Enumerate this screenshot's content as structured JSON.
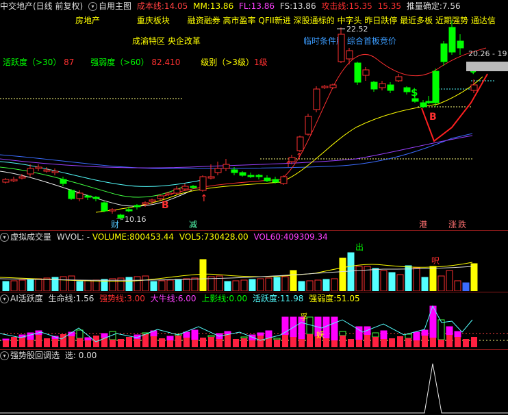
{
  "header": {
    "title": "中交地产(日线 前复权)",
    "custom_main": "自用主图",
    "cost_label": "成本线:",
    "cost_value": "14.05",
    "mm_label": "MM:",
    "mm_value": "13.86",
    "fl_label": "FL:",
    "fl_value": "13.86",
    "fs_label": "FS:",
    "fs_value": "13.86",
    "attack_label": "攻击线:",
    "attack_value1": "15.35",
    "attack_value2": "15.35",
    "push_label": "推量确定:",
    "push_value": "7.56"
  },
  "concepts": {
    "row1": [
      "房地产",
      "重庆板块",
      "融资融券",
      "高市盈率",
      "QFII新进",
      "深股通标的",
      "中字头",
      "昨日跌停",
      "最近多板",
      "近期强势",
      "通达信"
    ],
    "row2_left": "成渝特区 央企改革",
    "row2_right": "临时条件股 综合首板竞价",
    "row3_activity": "活跃度（>30）",
    "row3_activity_val": "87",
    "row3_strength": "强弱度（>60）",
    "row3_strength_val": "82.410",
    "row3_level": "级别（>3级）",
    "row3_level_val": "1级"
  },
  "price_pane": {
    "high_label": "22.52",
    "low_label": "10.16",
    "right_label": "20.26 - 19",
    "marks": {
      "b1": "B",
      "b2": "B",
      "s": "$",
      "s2": "$"
    },
    "bottom_tags": {
      "cai": "财",
      "jian": "减",
      "gang": "港",
      "zhang": "涨",
      "die": "跌"
    }
  },
  "vol_pane": {
    "title": "虚拟成交量",
    "wvol_label": "WVOL: -",
    "volume_label": "VOLUME:",
    "volume_value": "800453.44",
    "vol5_label": "VOL5:",
    "vol5_value": "730428.00",
    "vol60_label": "VOL60:",
    "vol60_value": "409309.34",
    "mark_out": "出",
    "mark_suo": "呎"
  },
  "ai_pane": {
    "title": "AI活跃度",
    "life_label": "生命线:",
    "life_value": "1.56",
    "strong_label": "强势线:",
    "strong_value": "3.00",
    "bull_label": "大牛线:",
    "bull_value": "6.00",
    "up_label": "上影线:",
    "up_value": "0.00",
    "act_label": "活跃度:",
    "act_value": "11.98",
    "str_label": "强弱度:",
    "str_value": "51.05",
    "mark_ya": "孚",
    "mark_yao": "妖"
  },
  "pullback_pane": {
    "title": "强势股回调选",
    "sel_label": "选:",
    "sel_value": "0.00"
  },
  "colors": {
    "up": "#ff3030",
    "down": "#00ff00",
    "cyan": "#54ffff",
    "yellow": "#ffff00",
    "magenta": "#ff00ff",
    "grid_red": "#8b1a1a"
  }
}
